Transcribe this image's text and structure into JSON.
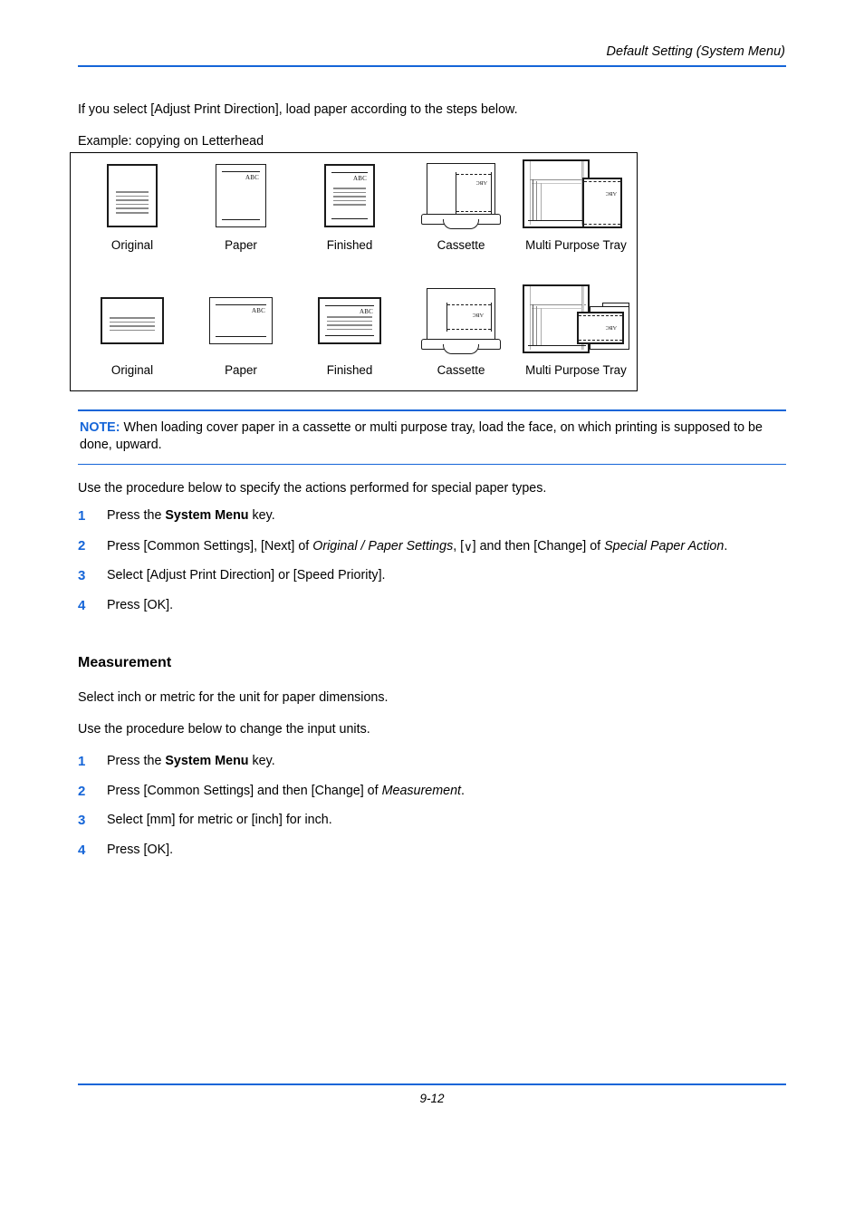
{
  "header": {
    "title": "Default Setting (System Menu)"
  },
  "intro": {
    "line1": "If you select [Adjust Print Direction], load paper according to the steps below.",
    "line2": "Example: copying on Letterhead"
  },
  "figure": {
    "rows": [
      {
        "orientation": "portrait",
        "cells": [
          {
            "label": "Original",
            "icon": "original-sheet-icon"
          },
          {
            "label": "Paper",
            "icon": "paper-sheet-icon",
            "mark": "Abc"
          },
          {
            "label": "Finished",
            "icon": "finished-sheet-icon",
            "mark": "Abc"
          },
          {
            "label": "Cassette",
            "icon": "cassette-icon",
            "mark": "Abc"
          },
          {
            "label": "Multi Purpose Tray",
            "icon": "multi-purpose-tray-icon",
            "mark": "Abc"
          }
        ]
      },
      {
        "orientation": "landscape",
        "cells": [
          {
            "label": "Original",
            "icon": "original-sheet-icon"
          },
          {
            "label": "Paper",
            "icon": "paper-sheet-icon",
            "mark": "Abc"
          },
          {
            "label": "Finished",
            "icon": "finished-sheet-icon",
            "mark": "Abc"
          },
          {
            "label": "Cassette",
            "icon": "cassette-icon",
            "mark": "Abc"
          },
          {
            "label": "Multi Purpose Tray",
            "icon": "multi-purpose-tray-icon",
            "mark": "Abc"
          }
        ]
      }
    ]
  },
  "note": {
    "label": "NOTE:",
    "text": "When loading cover paper in a cassette or multi purpose tray, load the face, on which printing is supposed to be done, upward."
  },
  "procedure1": {
    "intro": "Use the procedure below to specify the actions performed for special paper types.",
    "steps": [
      {
        "num": "1",
        "parts": [
          {
            "t": "Press the ",
            "s": "n"
          },
          {
            "t": "System Menu",
            "s": "b"
          },
          {
            "t": " key.",
            "s": "n"
          }
        ]
      },
      {
        "num": "2",
        "parts": [
          {
            "t": "Press [Common Settings], [Next] of ",
            "s": "n"
          },
          {
            "t": "Original / Paper Settings",
            "s": "i"
          },
          {
            "t": ", [",
            "s": "n"
          },
          {
            "t": "∨",
            "s": "chev"
          },
          {
            "t": "] and then [Change] of ",
            "s": "n"
          },
          {
            "t": "Special Paper Action",
            "s": "i"
          },
          {
            "t": ".",
            "s": "n"
          }
        ]
      },
      {
        "num": "3",
        "parts": [
          {
            "t": "Select [Adjust Print Direction] or [Speed Priority].",
            "s": "n"
          }
        ]
      },
      {
        "num": "4",
        "parts": [
          {
            "t": "Press [OK].",
            "s": "n"
          }
        ]
      }
    ]
  },
  "measurement": {
    "heading": "Measurement",
    "intro1": "Select inch or metric for the unit for paper dimensions.",
    "intro2": "Use the procedure below to change the input units.",
    "steps": [
      {
        "num": "1",
        "parts": [
          {
            "t": "Press the ",
            "s": "n"
          },
          {
            "t": "System Menu",
            "s": "b"
          },
          {
            "t": " key.",
            "s": "n"
          }
        ]
      },
      {
        "num": "2",
        "parts": [
          {
            "t": "Press [Common Settings] and then [Change] of ",
            "s": "n"
          },
          {
            "t": "Measurement",
            "s": "i"
          },
          {
            "t": ".",
            "s": "n"
          }
        ]
      },
      {
        "num": "3",
        "parts": [
          {
            "t": "Select [mm] for metric or [inch] for inch.",
            "s": "n"
          }
        ]
      },
      {
        "num": "4",
        "parts": [
          {
            "t": "Press [OK].",
            "s": "n"
          }
        ]
      }
    ]
  },
  "footer": {
    "page": "9-12"
  },
  "colors": {
    "accent_blue": "#1565d8",
    "text_black": "#000000",
    "rule_gray": "#8a8a8a"
  }
}
